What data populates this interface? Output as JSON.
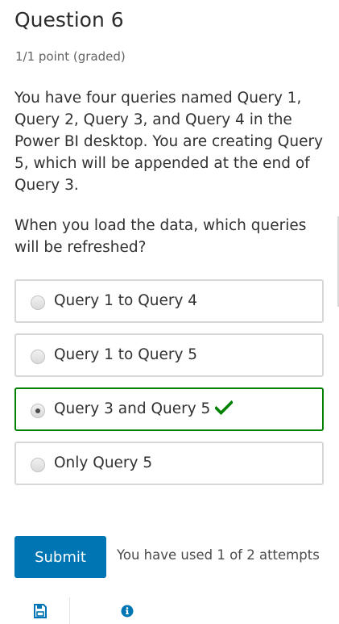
{
  "question": {
    "title": "Question 6",
    "points": "1/1 point (graded)",
    "paragraphs": [
      "You have four queries named Query 1, Query 2, Query 3, and Query 4 in the Power BI desktop. You are creating Query 5, which will be appended at the end of Query 3.",
      "When you load the data, which queries will be refreshed?"
    ]
  },
  "options": [
    {
      "label": "Query 1 to Query 4",
      "selected": false
    },
    {
      "label": "Query 1 to Query 5",
      "selected": false
    },
    {
      "label": "Query 3 and Query 5",
      "selected": true,
      "correct": true
    },
    {
      "label": "Only Query 5",
      "selected": false
    }
  ],
  "footer": {
    "submit_label": "Submit",
    "attempts_text": "You have used 1 of 2 attempts"
  },
  "icons": {
    "correct": "checkmark-icon",
    "save": "floppy-disk-icon",
    "info": "info-circle-icon"
  },
  "colors": {
    "accent": "#0075b4",
    "correct": "#008100",
    "border": "#d7d7d7"
  }
}
